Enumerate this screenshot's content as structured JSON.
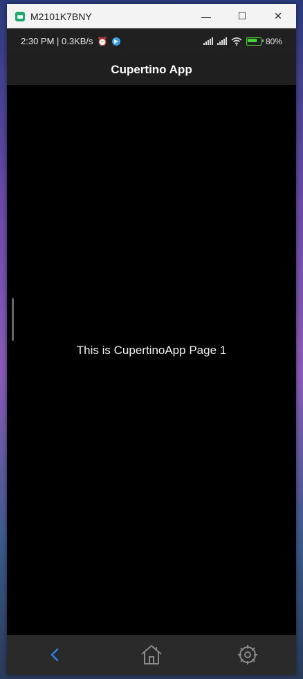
{
  "window": {
    "title": "M2101K7BNY",
    "minimize": "—",
    "maximize": "☐",
    "close": "✕"
  },
  "status": {
    "left": "2:30 PM | 0.3KB/s",
    "alarm": "⏰",
    "battery": "80%"
  },
  "navbar": {
    "title": "Cupertino App"
  },
  "main": {
    "text": "This is CupertinoApp Page 1"
  },
  "tabs": [
    {
      "icon": "back-chevron-icon",
      "color": "#2f7fe0"
    },
    {
      "icon": "home-icon",
      "color": "#8a8a8a"
    },
    {
      "icon": "settings-icon",
      "color": "#8a8a8a"
    }
  ]
}
